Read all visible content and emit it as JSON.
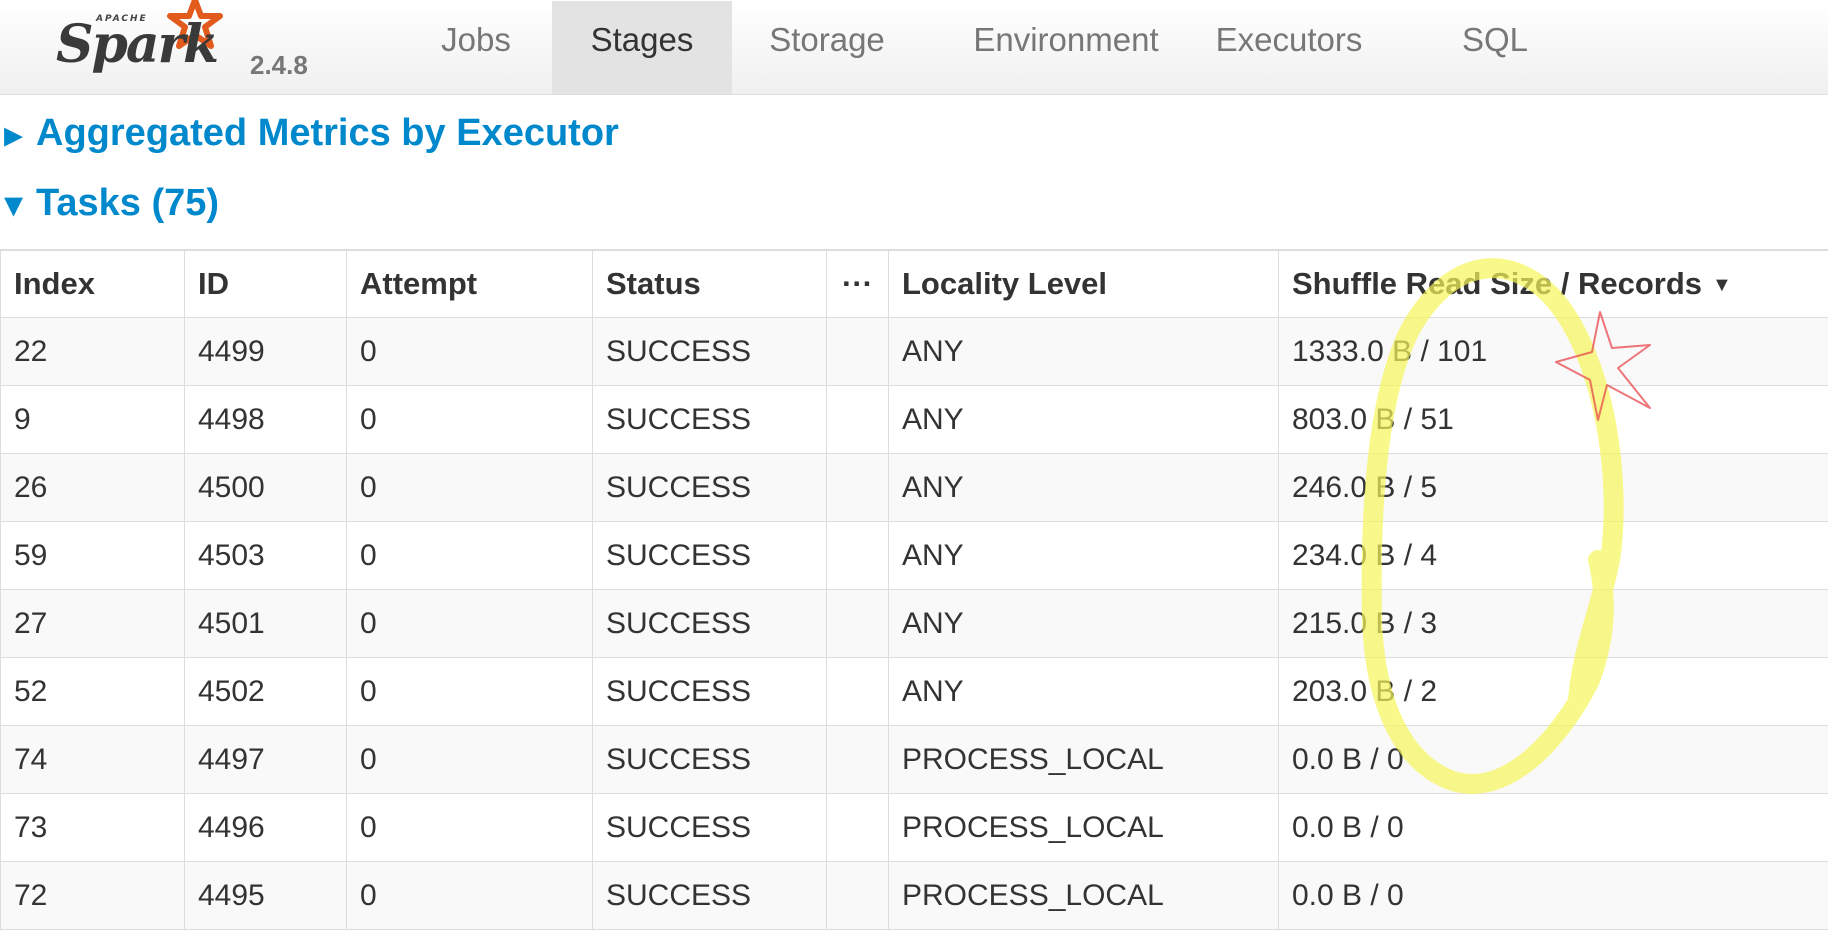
{
  "brand": {
    "apache": "APACHE",
    "name": "Spark",
    "version": "2.4.8",
    "star_color": "#e25a1c"
  },
  "nav": {
    "items": [
      {
        "label": "Jobs",
        "active": false
      },
      {
        "label": "Stages",
        "active": true
      },
      {
        "label": "Storage",
        "active": false
      },
      {
        "label": "Environment",
        "active": false
      },
      {
        "label": "Executors",
        "active": false
      },
      {
        "label": "SQL",
        "active": false
      }
    ]
  },
  "sections": {
    "aggregated": {
      "caret": "▸",
      "label": "Aggregated Metrics by Executor",
      "expanded": false
    },
    "tasks": {
      "caret": "▾",
      "label": "Tasks (75)",
      "expanded": true
    }
  },
  "table": {
    "columns": [
      "Index",
      "ID",
      "Attempt",
      "Status",
      "···",
      "Locality Level",
      "Shuffle Read Size / Records"
    ],
    "sort_indicator": "▼",
    "rows": [
      [
        "22",
        "4499",
        "0",
        "SUCCESS",
        "",
        "ANY",
        "1333.0 B / 101"
      ],
      [
        "9",
        "4498",
        "0",
        "SUCCESS",
        "",
        "ANY",
        "803.0 B / 51"
      ],
      [
        "26",
        "4500",
        "0",
        "SUCCESS",
        "",
        "ANY",
        "246.0 B / 5"
      ],
      [
        "59",
        "4503",
        "0",
        "SUCCESS",
        "",
        "ANY",
        "234.0 B / 4"
      ],
      [
        "27",
        "4501",
        "0",
        "SUCCESS",
        "",
        "ANY",
        "215.0 B / 3"
      ],
      [
        "52",
        "4502",
        "0",
        "SUCCESS",
        "",
        "ANY",
        "203.0 B / 2"
      ],
      [
        "74",
        "4497",
        "0",
        "SUCCESS",
        "",
        "PROCESS_LOCAL",
        "0.0 B / 0"
      ],
      [
        "73",
        "4496",
        "0",
        "SUCCESS",
        "",
        "PROCESS_LOCAL",
        "0.0 B / 0"
      ],
      [
        "72",
        "4495",
        "0",
        "SUCCESS",
        "",
        "PROCESS_LOCAL",
        "0.0 B / 0"
      ]
    ]
  },
  "annotations": {
    "highlight_color": "#f7f75a",
    "star_color": "#e8484c"
  },
  "colors": {
    "link": "#0088cc",
    "nav_active_bg": "#e3e3e3",
    "border": "#dddddd",
    "stripe": "#f9f9f9"
  }
}
